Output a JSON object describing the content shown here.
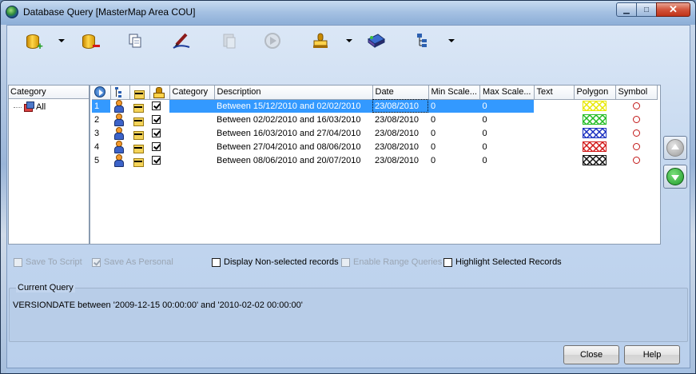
{
  "window": {
    "title": "Database Query [MasterMap Area COU]",
    "controls": [
      "minimize",
      "maximize",
      "close"
    ]
  },
  "toolbar": {
    "buttons": [
      {
        "icon": "database-add-icon",
        "enabled": true,
        "dropdown": true
      },
      {
        "icon": "database-remove-icon",
        "enabled": true,
        "dropdown": false
      },
      {
        "icon": "copy-icon",
        "enabled": true,
        "dropdown": false
      },
      {
        "icon": "edit-pen-icon",
        "enabled": true,
        "dropdown": false
      },
      {
        "icon": "paste-icon",
        "enabled": false,
        "dropdown": false
      },
      {
        "icon": "run-query-icon",
        "enabled": false,
        "dropdown": false
      },
      {
        "icon": "stamp-icon",
        "enabled": true,
        "dropdown": true
      },
      {
        "icon": "book-icon",
        "enabled": true,
        "dropdown": false
      },
      {
        "icon": "tree-icon",
        "enabled": true,
        "dropdown": true
      }
    ]
  },
  "category_panel": {
    "header": "Category",
    "items": [
      {
        "label": "All"
      }
    ]
  },
  "grid": {
    "columns": {
      "category": "Category",
      "description": "Description",
      "date": "Date",
      "min_scale": "Min Scale...",
      "max_scale": "Max Scale...",
      "text": "Text",
      "polygon": "Polygon",
      "symbol": "Symbol"
    },
    "rows": [
      {
        "num": "1",
        "checked": true,
        "category": "",
        "description": "Between 15/12/2010 and 02/02/2010",
        "date": "23/08/2010",
        "min_scale": "0",
        "max_scale": "0",
        "text": "",
        "polygon_color": "#e8e800",
        "symbol_color": "#c21818",
        "selected": true
      },
      {
        "num": "2",
        "checked": true,
        "category": "",
        "description": "Between 02/02/2010 and 16/03/2010",
        "date": "23/08/2010",
        "min_scale": "0",
        "max_scale": "0",
        "text": "",
        "polygon_color": "#22bb22",
        "symbol_color": "#c21818",
        "selected": false
      },
      {
        "num": "3",
        "checked": true,
        "category": "",
        "description": "Between 16/03/2010 and 27/04/2010",
        "date": "23/08/2010",
        "min_scale": "0",
        "max_scale": "0",
        "text": "",
        "polygon_color": "#1a2fc0",
        "symbol_color": "#c21818",
        "selected": false
      },
      {
        "num": "4",
        "checked": true,
        "category": "",
        "description": "Between 27/04/2010 and 08/06/2010",
        "date": "23/08/2010",
        "min_scale": "0",
        "max_scale": "0",
        "text": "",
        "polygon_color": "#d21a1a",
        "symbol_color": "#c21818",
        "selected": false
      },
      {
        "num": "5",
        "checked": true,
        "category": "",
        "description": "Between 08/06/2010 and 20/07/2010",
        "date": "23/08/2010",
        "min_scale": "0",
        "max_scale": "0",
        "text": "",
        "polygon_color": "#111111",
        "symbol_color": "#c21818",
        "selected": false
      }
    ]
  },
  "options": {
    "save_to_script": {
      "label": "Save To Script",
      "checked": false,
      "enabled": false
    },
    "save_as_personal": {
      "label": "Save As Personal",
      "checked": true,
      "enabled": false
    },
    "display_non_selected": {
      "label": "Display Non-selected records",
      "checked": false,
      "enabled": true
    },
    "enable_range_queries": {
      "label": "Enable Range Queries",
      "checked": false,
      "enabled": false
    },
    "highlight_selected": {
      "label": "Highlight Selected Records",
      "checked": false,
      "enabled": true
    }
  },
  "current_query": {
    "label": "Current Query",
    "text": "VERSIONDATE between '2009-12-15 00:00:00' and  '2010-02-02 00:00:00'"
  },
  "buttons": {
    "close": "Close",
    "help": "Help"
  },
  "colors": {
    "selection": "#3399ff",
    "client_bg": "#c5d8ef"
  }
}
